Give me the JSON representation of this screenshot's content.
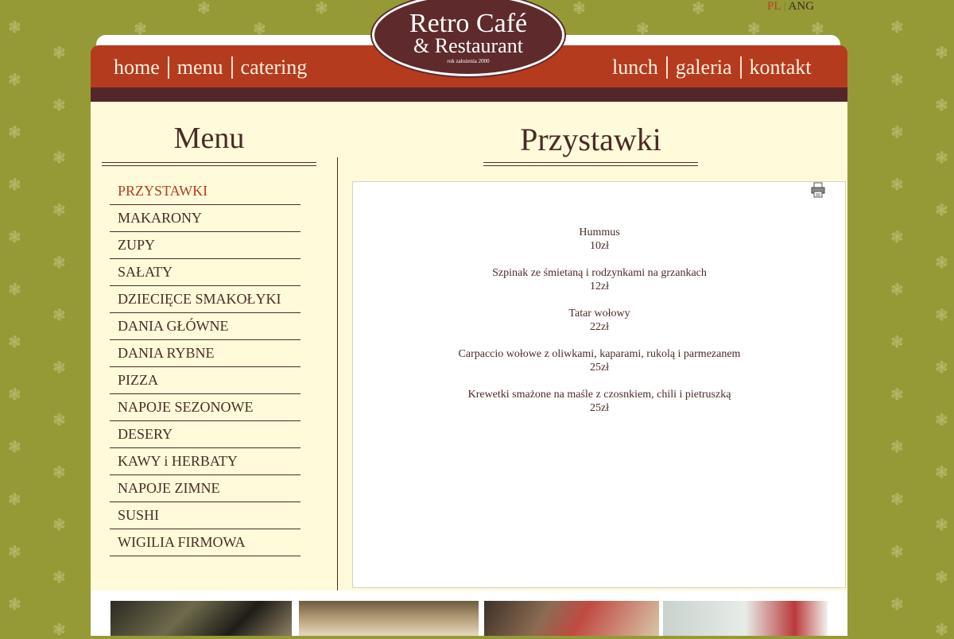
{
  "language": {
    "pl": "PL",
    "separator": "|",
    "en": "ANG"
  },
  "logo": {
    "line1": "Retro Café",
    "line2": "& Restaurant",
    "tagline": "rok założenia 2000"
  },
  "nav": {
    "left": [
      "home",
      "menu",
      "catering"
    ],
    "right": [
      "lunch",
      "galeria",
      "kontakt"
    ]
  },
  "sidebar": {
    "title": "Menu",
    "items": [
      "PRZYSTAWKI",
      "MAKARONY",
      "ZUPY",
      "SAŁATY",
      "DZIECIĘCE SMAKOŁYKI",
      "DANIA GŁÓWNE",
      "DANIA RYBNE",
      "PIZZA",
      "NAPOJE SEZONOWE",
      "DESERY",
      "KAWY i HERBATY",
      "NAPOJE ZIMNE",
      "SUSHI",
      "WIGILIA FIRMOWA"
    ],
    "active_index": 0
  },
  "main": {
    "title": "Przystawki",
    "items": [
      {
        "name": "Hummus",
        "price": "10zł"
      },
      {
        "name": "Szpinak ze śmietaną  i rodzynkami na grzankach",
        "price": "12zł"
      },
      {
        "name": "Tatar wołowy",
        "price": "22zł"
      },
      {
        "name": "Carpaccio  wołowe z oliwkami, kaparami, rukolą i parmezanem",
        "price": "25zł"
      },
      {
        "name": "Krewetki smażone na maśle z czosnkiem, chili i pietruszką",
        "price": "25zł"
      }
    ]
  },
  "icons": {
    "print": "printer-icon",
    "background": "snowflake-ornament"
  },
  "colors": {
    "background": "#969a36",
    "navbar": "#b53b1f",
    "strip": "#53262a",
    "content": "#fffbda",
    "text": "#4b2a26",
    "active": "#b53b1f"
  }
}
